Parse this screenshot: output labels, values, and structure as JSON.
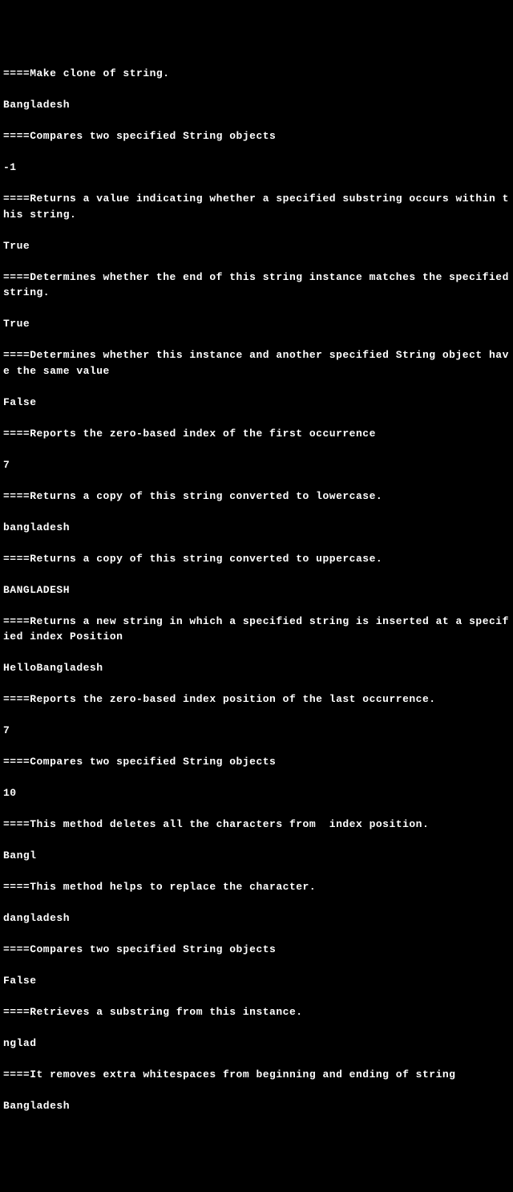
{
  "lines": [
    "====Make clone of string.",
    "",
    "Bangladesh",
    "",
    "====Compares two specified String objects",
    "",
    "-1",
    "",
    "====Returns a value indicating whether a specified substring occurs within this string.",
    "",
    "True",
    "",
    "====Determines whether the end of this string instance matches the specified string.",
    "",
    "True",
    "",
    "====Determines whether this instance and another specified String object have the same value",
    "",
    "False",
    "",
    "====Reports the zero-based index of the first occurrence",
    "",
    "7",
    "",
    "====Returns a copy of this string converted to lowercase.",
    "",
    "bangladesh",
    "",
    "====Returns a copy of this string converted to uppercase.",
    "",
    "BANGLADESH",
    "",
    "====Returns a new string in which a specified string is inserted at a specified index Position",
    "",
    "HelloBangladesh",
    "",
    "====Reports the zero-based index position of the last occurrence.",
    "",
    "7",
    "",
    "====Compares two specified String objects",
    "",
    "10",
    "",
    "====This method deletes all the characters from  index position.",
    "",
    "Bangl",
    "",
    "====This method helps to replace the character.",
    "",
    "dangladesh",
    "",
    "====Compares two specified String objects",
    "",
    "False",
    "",
    "====Retrieves a substring from this instance.",
    "",
    "nglad",
    "",
    "====It removes extra whitespaces from beginning and ending of string",
    "",
    "Bangladesh"
  ]
}
